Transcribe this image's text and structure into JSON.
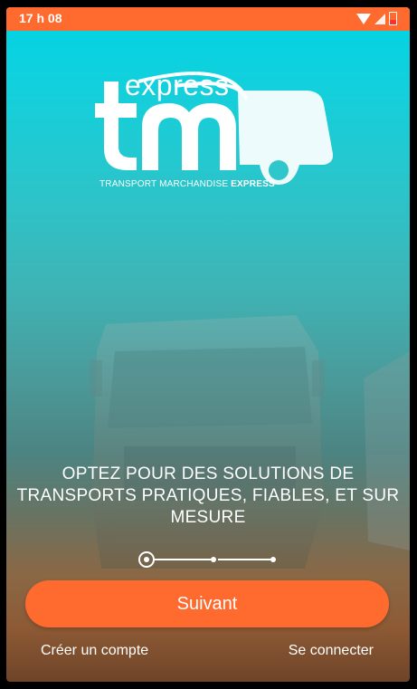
{
  "status_bar": {
    "time": "17 h 08",
    "icons": [
      "wifi-icon",
      "signal-icon",
      "battery-icon"
    ],
    "color": "#ff6a2e"
  },
  "logo": {
    "word": "express",
    "tagline_regular": "TRANSPORT MARCHANDISE ",
    "tagline_bold": "EXPRESS"
  },
  "onboarding": {
    "headline": "OPTEZ POUR DES SOLUTIONS DE TRANSPORTS PRATIQUES, FIABLES, ET SUR MESURE",
    "pager": {
      "total": 3,
      "current": 1
    }
  },
  "actions": {
    "next_label": "Suivant",
    "create_account_label": "Créer un compte",
    "login_label": "Se connecter"
  },
  "colors": {
    "accent": "#ff6a2e",
    "text": "#ffffff",
    "background_top": "#00d4e4"
  }
}
